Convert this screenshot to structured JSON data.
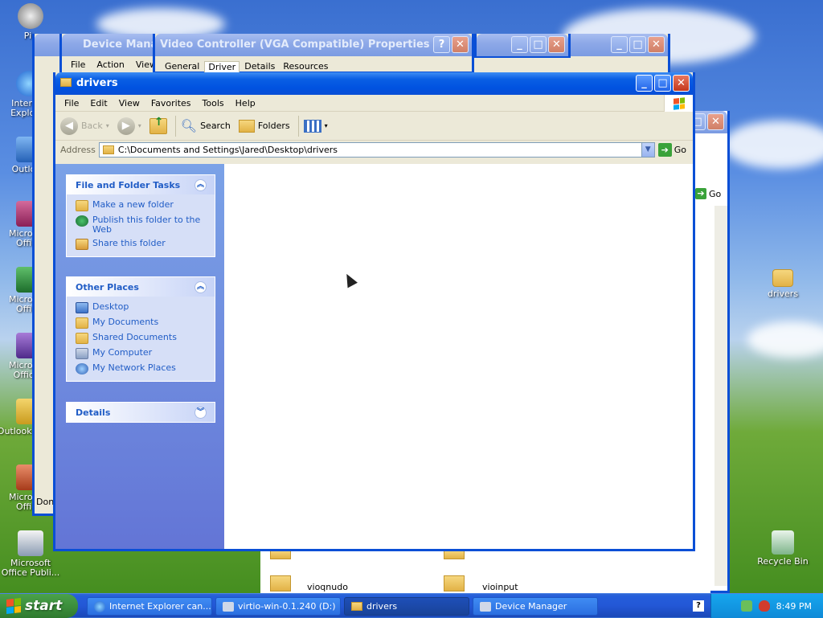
{
  "desktop_icons": [
    {
      "label": "Pin",
      "kind": "pin"
    },
    {
      "label": "Internet Explorer",
      "kind": "ie"
    },
    {
      "label": "Outlook",
      "kind": "out"
    },
    {
      "label": "Microsoft Office",
      "kind": "office"
    },
    {
      "label": "Microsoft Office",
      "kind": "excel"
    },
    {
      "label": "Microsoft Office I",
      "kind": "onenote"
    },
    {
      "label": "Outlook Office",
      "kind": "outlook"
    },
    {
      "label": "Microsoft Office",
      "kind": "access"
    },
    {
      "label": "Microsoft Office Publi...",
      "kind": "publisher"
    }
  ],
  "right_icons": {
    "drivers": "drivers",
    "recycle": "Recycle Bin"
  },
  "bg_windows": {
    "device_manager": {
      "title": "Device Manager",
      "menu": [
        "File",
        "Action",
        "View"
      ]
    },
    "vga": {
      "title": "Video Controller (VGA Compatible) Properties",
      "tabs": [
        "General",
        "Driver",
        "Details",
        "Resources"
      ]
    },
    "ie": {
      "status": "Done"
    },
    "right": {
      "go": "Go",
      "files": [
        "vioqnudo",
        "vioinput"
      ]
    }
  },
  "window": {
    "title": "drivers",
    "menu": [
      "File",
      "Edit",
      "View",
      "Favorites",
      "Tools",
      "Help"
    ],
    "toolbar": {
      "back": "Back",
      "search": "Search",
      "folders": "Folders"
    },
    "address_label": "Address",
    "address": "C:\\Documents and Settings\\Jared\\Desktop\\drivers",
    "go": "Go"
  },
  "tasks": {
    "file_folder": {
      "title": "File and Folder Tasks",
      "links": [
        "Make a new folder",
        "Publish this folder to the Web",
        "Share this folder"
      ]
    },
    "other_places": {
      "title": "Other Places",
      "links": [
        "Desktop",
        "My Documents",
        "Shared Documents",
        "My Computer",
        "My Network Places"
      ]
    },
    "details": {
      "title": "Details"
    }
  },
  "taskbar": {
    "start": "start",
    "tasks": [
      "Internet Explorer can...",
      "virtio-win-0.1.240 (D:)",
      "drivers",
      "Device Manager"
    ],
    "clock": "8:49 PM"
  },
  "colors": {
    "accent": "#0a4fd6",
    "link": "#215dc6",
    "start_green": "#3c8f3c"
  }
}
